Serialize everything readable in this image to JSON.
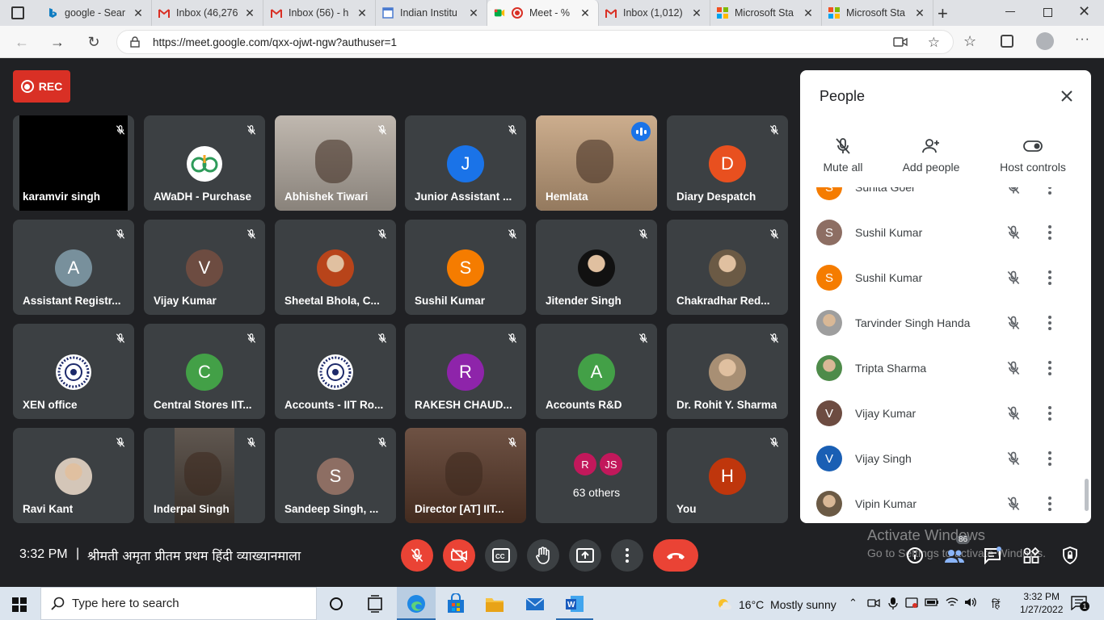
{
  "browser": {
    "tabs": [
      {
        "label": "google - Sear",
        "favicon": "bing-icon",
        "color": "#0f7dc2"
      },
      {
        "label": "Inbox (46,276",
        "favicon": "gmail-icon",
        "color": "#d93025"
      },
      {
        "label": "Inbox (56) - h",
        "favicon": "gmail-icon",
        "color": "#d93025"
      },
      {
        "label": "Indian Institu",
        "favicon": "calendar-icon",
        "color": "#4a7bd0"
      },
      {
        "label": "Meet - %",
        "favicon": "meet-icon",
        "color": "#00832d"
      },
      {
        "label": "Inbox (1,012)",
        "favicon": "gmail-icon",
        "color": "#d93025"
      },
      {
        "label": "Microsoft Sta",
        "favicon": "microsoft-icon",
        "color": "#f25022"
      },
      {
        "label": "Microsoft Sta",
        "favicon": "microsoft-icon",
        "color": "#f25022"
      }
    ],
    "url": "https://meet.google.com/qxx-ojwt-ngw?authuser=1"
  },
  "meet": {
    "rec_label": "REC",
    "tiles": [
      {
        "name": "karamvir singh",
        "type": "video",
        "bg": "#000000"
      },
      {
        "name": "AWaDH - Purchase",
        "type": "logo",
        "bg": "#3c4043"
      },
      {
        "name": "Abhishek Tiwari",
        "type": "video",
        "bg": "#b7aea4"
      },
      {
        "name": "Junior Assistant ...",
        "type": "initial",
        "initial": "J",
        "color": "#1a73e8"
      },
      {
        "name": "Hemlata",
        "type": "video",
        "bg": "#c5a27e",
        "speaking": true
      },
      {
        "name": "Diary Despatch",
        "type": "initial",
        "initial": "D",
        "color": "#e8501f"
      },
      {
        "name": "Assistant Registr...",
        "type": "initial",
        "initial": "A",
        "color": "#78909c"
      },
      {
        "name": "Vijay Kumar",
        "type": "initial",
        "initial": "V",
        "color": "#6d4c41"
      },
      {
        "name": "Sheetal Bhola, C...",
        "type": "photo",
        "color": "#b8441a"
      },
      {
        "name": "Sushil Kumar",
        "type": "initial",
        "initial": "S",
        "color": "#f57c00"
      },
      {
        "name": "Jitender Singh",
        "type": "photo",
        "color": "#111111"
      },
      {
        "name": "Chakradhar Red...",
        "type": "photo",
        "color": "#6b5a45"
      },
      {
        "name": "XEN office",
        "type": "emblem"
      },
      {
        "name": "Central Stores IIT...",
        "type": "initial",
        "initial": "C",
        "color": "#43a047"
      },
      {
        "name": "Accounts - IIT Ro...",
        "type": "emblem"
      },
      {
        "name": "RAKESH CHAUD...",
        "type": "initial",
        "initial": "R",
        "color": "#8e24aa"
      },
      {
        "name": "Accounts R&D",
        "type": "initial",
        "initial": "A",
        "color": "#43a047"
      },
      {
        "name": "Dr. Rohit Y. Sharma",
        "type": "photo",
        "color": "#a88f74"
      },
      {
        "name": "Ravi Kant",
        "type": "photo",
        "color": "#d4c6b8"
      },
      {
        "name": "Inderpal Singh",
        "type": "video",
        "bg": "#4a4038"
      },
      {
        "name": "Sandeep Singh, ...",
        "type": "initial",
        "initial": "S",
        "color": "#8d6e63"
      },
      {
        "name": "Director [AT] IIT...",
        "type": "video",
        "bg": "#5a3a2a"
      },
      {
        "name": "63 others",
        "type": "others",
        "initials": [
          "R",
          "JS"
        ]
      },
      {
        "name": "You",
        "type": "initial",
        "initial": "H",
        "color": "#bf360c"
      }
    ],
    "clock": "3:32 PM",
    "separator": "|",
    "meeting_title": "श्रीमती अमृता प्रीतम प्रथम हिंदी व्याख्यानमाला",
    "people_count": "86"
  },
  "people_panel": {
    "title": "People",
    "actions": [
      {
        "label": "Mute all",
        "icon": "mic-off-icon"
      },
      {
        "label": "Add people",
        "icon": "add-person-icon"
      },
      {
        "label": "Host controls",
        "icon": "toggle-icon"
      }
    ],
    "people": [
      {
        "name": "Sunita Goel",
        "initial": "S",
        "color": "#f57c00"
      },
      {
        "name": "Sushil Kumar",
        "initial": "S",
        "color": "#8d6e63"
      },
      {
        "name": "Sushil Kumar",
        "initial": "S",
        "color": "#f57c00"
      },
      {
        "name": "Tarvinder Singh Handa",
        "initial": "",
        "color": "#9e9e9e",
        "photo": true
      },
      {
        "name": "Tripta Sharma",
        "initial": "",
        "color": "#4e8b4a",
        "photo": true
      },
      {
        "name": "Vijay Kumar",
        "initial": "V",
        "color": "#6d4c41"
      },
      {
        "name": "Vijay Singh",
        "initial": "V",
        "color": "#1a5fb4"
      },
      {
        "name": "Vipin Kumar",
        "initial": "",
        "color": "#6b5a45",
        "photo": true
      }
    ]
  },
  "watermark": {
    "line1": "Activate Windows",
    "line2": "Go to Settings to activate Windows."
  },
  "taskbar": {
    "search_placeholder": "Type here to search",
    "weather": "16°C  Mostly sunny",
    "time": "3:32 PM",
    "date": "1/27/2022",
    "lang": "हिं",
    "notifications": "1"
  }
}
